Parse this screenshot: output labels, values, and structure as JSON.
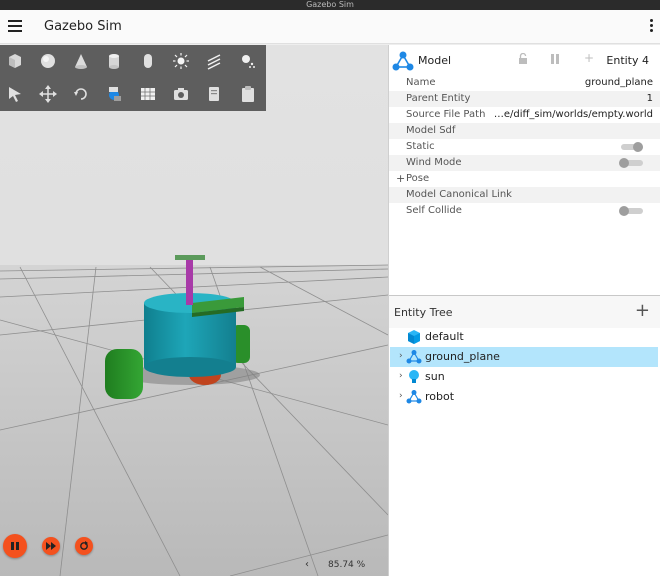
{
  "os_bar": {
    "title": "Gazebo Sim"
  },
  "header": {
    "title": "Gazebo Sim"
  },
  "toolbar": {
    "row1": [
      "box-icon",
      "sphere-icon",
      "cone-icon",
      "cylinder-icon",
      "capsule-icon",
      "point-light-icon",
      "directional-light-icon",
      "spot-light-icon"
    ],
    "row2": [
      "select-icon",
      "translate-icon",
      "rotate-icon",
      "transform-icon",
      "grid-icon",
      "screenshot-icon",
      "copy-icon",
      "paste-icon"
    ]
  },
  "playback": {
    "real_time_factor": "85.74 %"
  },
  "component_inspector": {
    "type_label": "Model",
    "entity_label": "Entity 4",
    "properties": [
      {
        "key": "Name",
        "value": "ground_plane"
      },
      {
        "key": "Parent Entity",
        "value": "1"
      },
      {
        "key": "Source File Path",
        "value": "…e/diff_sim/worlds/empty.world"
      },
      {
        "key": "Model Sdf",
        "value": ""
      },
      {
        "key": "Static",
        "toggle_on": true
      },
      {
        "key": "Wind Mode",
        "toggle_on": false
      },
      {
        "key": "Pose",
        "value": "",
        "prefix": "+"
      },
      {
        "key": "Model Canonical Link",
        "value": ""
      },
      {
        "key": "Self Collide",
        "toggle_on": false
      }
    ]
  },
  "entity_tree": {
    "title": "Entity Tree",
    "items": [
      {
        "name": "default",
        "icon": "world-icon",
        "expandable": false,
        "selected": false
      },
      {
        "name": "ground_plane",
        "icon": "model-icon",
        "expandable": true,
        "selected": true
      },
      {
        "name": "sun",
        "icon": "light-bulb-icon",
        "expandable": true,
        "selected": false
      },
      {
        "name": "robot",
        "icon": "model-icon",
        "expandable": true,
        "selected": false
      }
    ]
  },
  "colors": {
    "accent": "#f4511e",
    "selection": "#b3e5fc",
    "robot_body": "#1e9fb0",
    "robot_wheels": "#2e9a2e",
    "robot_caster": "#c0441e",
    "robot_mast": "#a83aa8"
  }
}
